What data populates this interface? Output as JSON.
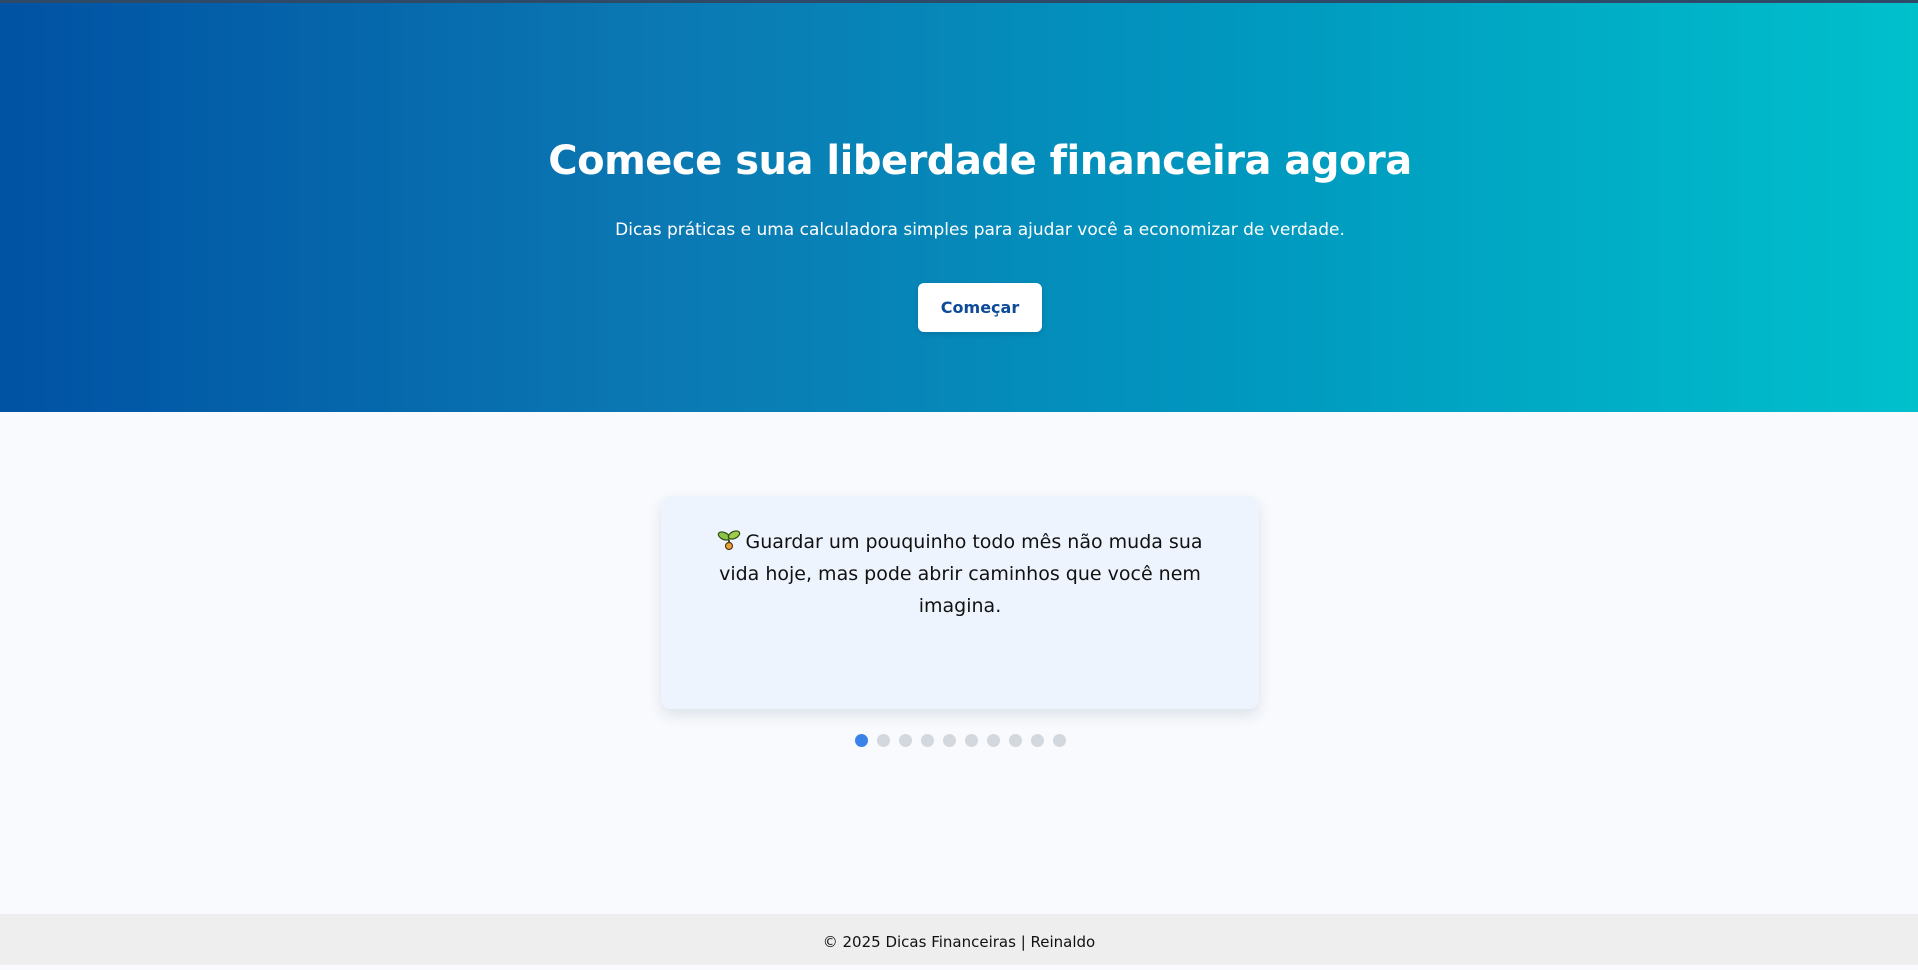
{
  "hero": {
    "title": "Comece sua liberdade financeira agora",
    "subtitle": "Dicas práticas e uma calculadora simples para ajudar você a economizar de verdade.",
    "cta_label": "Começar"
  },
  "tips": {
    "current_text": "Guardar um pouquinho todo mês não muda sua vida hoje, mas pode abrir caminhos que você nem imagina.",
    "current_icon": "sprout-icon",
    "total": 10,
    "active_index": 0
  },
  "footer": {
    "text": "© 2025 Dicas Financeiras | Reinaldo"
  },
  "colors": {
    "hero_gradient_start": "#0052a3",
    "hero_gradient_end": "#00c0cc",
    "cta_text": "#0d4a99",
    "dot_active": "#3b82e8",
    "dot_inactive": "#d3d8df"
  }
}
